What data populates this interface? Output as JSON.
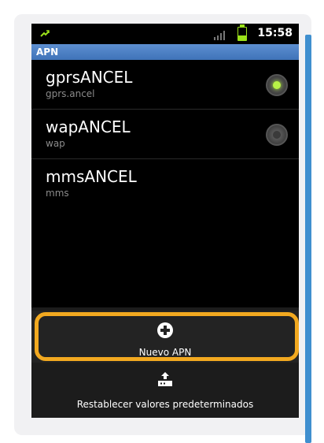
{
  "status_bar": {
    "time": "15:58",
    "sync_icon": "sync-icon",
    "signal_icon": "signal-icon",
    "battery_icon": "battery-icon"
  },
  "titlebar": {
    "title": "APN"
  },
  "apn_list": [
    {
      "name": "gprsANCEL",
      "apn": "gprs.ancel",
      "selected": true
    },
    {
      "name": "wapANCEL",
      "apn": "wap",
      "selected": false
    },
    {
      "name": "mmsANCEL",
      "apn": "mms",
      "selected": null
    }
  ],
  "menu": {
    "new_apn_label": "Nuevo APN",
    "new_apn_icon": "plus-circle-icon",
    "reset_label": "Restablecer valores predeterminados",
    "reset_icon": "reset-icon"
  },
  "colors": {
    "titlebar": "#4a7fc3",
    "highlight_outline": "#f2a920",
    "radio_selected": "#9be11a",
    "accent_bar": "#3f8fcf"
  }
}
